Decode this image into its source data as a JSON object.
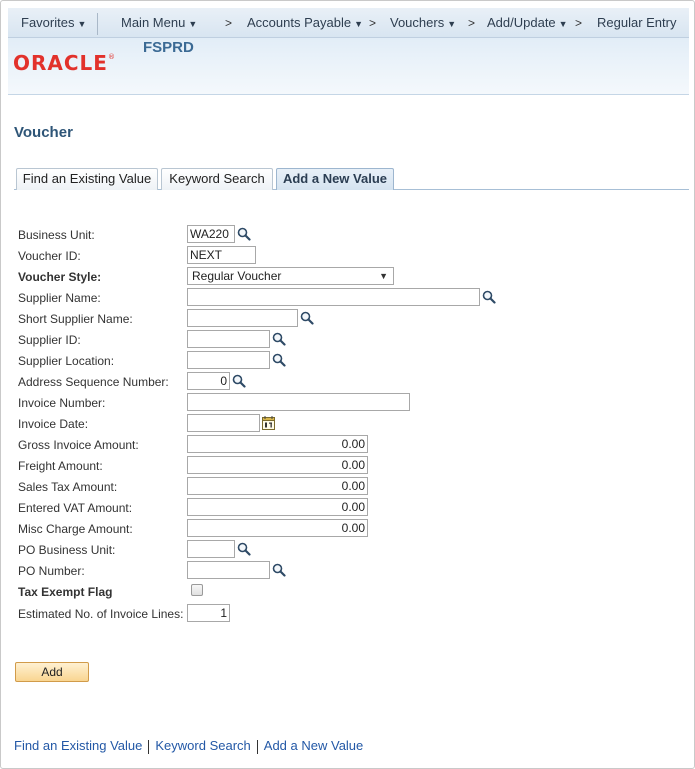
{
  "nav": {
    "favorites": "Favorites",
    "main_menu": "Main Menu",
    "breadcrumbs": [
      "Accounts Payable",
      "Vouchers",
      "Add/Update",
      "Regular Entry"
    ],
    "separator": ">"
  },
  "header": {
    "logo": "ORACLE",
    "logo_mark": "®",
    "environment": "FSPRD"
  },
  "page": {
    "title": "Voucher"
  },
  "tabs": [
    {
      "label": "Find an Existing Value",
      "active": false
    },
    {
      "label": "Keyword Search",
      "active": false
    },
    {
      "label": "Add a New Value",
      "active": true
    }
  ],
  "form": {
    "business_unit": {
      "label": "Business Unit:",
      "value": "WA220"
    },
    "voucher_id": {
      "label": "Voucher ID:",
      "value": "NEXT"
    },
    "voucher_style": {
      "label": "Voucher Style:",
      "value": "Regular Voucher"
    },
    "supplier_name": {
      "label": "Supplier Name:",
      "value": ""
    },
    "short_supplier_name": {
      "label": "Short Supplier Name:",
      "value": ""
    },
    "supplier_id": {
      "label": "Supplier ID:",
      "value": ""
    },
    "supplier_location": {
      "label": "Supplier Location:",
      "value": ""
    },
    "address_sequence_number": {
      "label": "Address Sequence Number:",
      "value": "0"
    },
    "invoice_number": {
      "label": "Invoice Number:",
      "value": ""
    },
    "invoice_date": {
      "label": "Invoice Date:",
      "value": ""
    },
    "gross_invoice_amount": {
      "label": "Gross Invoice Amount:",
      "value": "0.00"
    },
    "freight_amount": {
      "label": "Freight Amount:",
      "value": "0.00"
    },
    "sales_tax_amount": {
      "label": "Sales Tax Amount:",
      "value": "0.00"
    },
    "entered_vat_amount": {
      "label": "Entered VAT Amount:",
      "value": "0.00"
    },
    "misc_charge_amount": {
      "label": "Misc Charge Amount:",
      "value": "0.00"
    },
    "po_business_unit": {
      "label": "PO Business Unit:",
      "value": ""
    },
    "po_number": {
      "label": "PO Number:",
      "value": ""
    },
    "tax_exempt_flag": {
      "label": "Tax Exempt Flag",
      "checked": false
    },
    "estimated_invoice_lines": {
      "label": "Estimated No. of Invoice Lines:",
      "value": "1"
    }
  },
  "buttons": {
    "add": "Add"
  },
  "footer_links": [
    "Find an Existing Value",
    "Keyword Search",
    "Add a New Value"
  ],
  "icons": {
    "lookup": "magnifier-icon",
    "calendar": "calendar-icon",
    "dropdown": "chevron-down-icon"
  },
  "colors": {
    "logo_red": "#e2312b",
    "link_blue": "#2358a6",
    "title_blue": "#2e5577",
    "button_fill": "#f9d591"
  }
}
